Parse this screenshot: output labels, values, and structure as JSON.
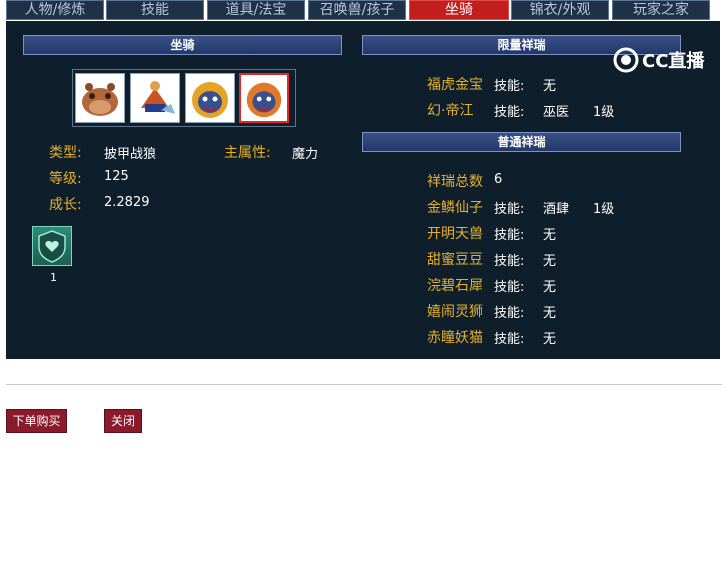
{
  "tabs": [
    "人物/修炼",
    "技能",
    "道具/法宝",
    "召唤兽/孩子",
    "坐骑",
    "锦衣/外观",
    "玩家之家"
  ],
  "active_tab": "坐骑",
  "left_header": "坐骑",
  "mount": {
    "type_label": "类型:",
    "type_value": "披甲战狼",
    "main_attr_label": "主属性:",
    "main_attr_value": "魔力",
    "level_label": "等级:",
    "level_value": "125",
    "growth_label": "成长:",
    "growth_value": "2.2829"
  },
  "skill_count": "1",
  "limited_header": "限量祥瑞",
  "limited": [
    {
      "name": "福虎金宝",
      "skill_label": "技能:",
      "skill": "无",
      "level": ""
    },
    {
      "name": "幻·帝江",
      "skill_label": "技能:",
      "skill": "巫医",
      "level": "1级"
    }
  ],
  "normal_header": "普通祥瑞",
  "normal_total_label": "祥瑞总数",
  "normal_total_value": "6",
  "normal": [
    {
      "name": "金鳞仙子",
      "skill_label": "技能:",
      "skill": "酒肆",
      "level": "1级"
    },
    {
      "name": "开明天兽",
      "skill_label": "技能:",
      "skill": "无",
      "level": ""
    },
    {
      "name": "甜蜜豆豆",
      "skill_label": "技能:",
      "skill": "无",
      "level": ""
    },
    {
      "name": "浣碧石犀",
      "skill_label": "技能:",
      "skill": "无",
      "level": ""
    },
    {
      "name": "嬉闹灵狮",
      "skill_label": "技能:",
      "skill": "无",
      "level": ""
    },
    {
      "name": "赤瞳妖猫",
      "skill_label": "技能:",
      "skill": "无",
      "level": ""
    }
  ],
  "watermark": "CC直播",
  "buttons": {
    "buy": "下单购买",
    "close": "关闭"
  },
  "colors": {
    "accent_red": "#c21e1e",
    "label_gold": "#e3b12d",
    "panel_bg": "#0f1e2b",
    "button_bg": "#8b1a2b"
  }
}
